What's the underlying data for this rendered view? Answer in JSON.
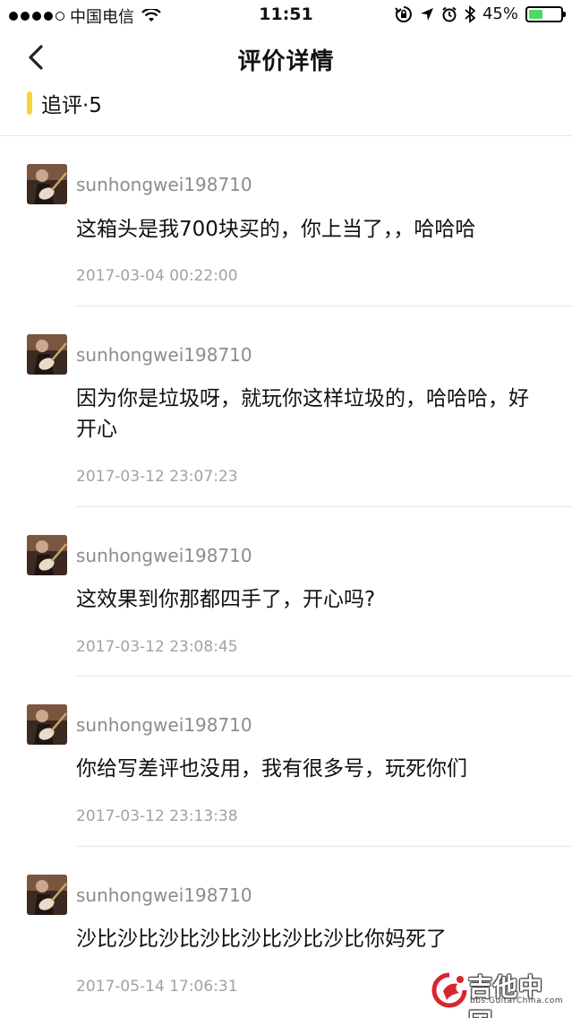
{
  "status_bar": {
    "carrier": "中国电信",
    "time": "11:51",
    "battery_percent": "45%",
    "battery_level": 0.45,
    "icons": [
      "wifi-icon",
      "lock-rotation-icon",
      "location-icon",
      "alarm-icon",
      "bluetooth-icon",
      "battery-icon"
    ]
  },
  "nav": {
    "title": "评价详情",
    "back_icon": "chevron-left-icon"
  },
  "section": {
    "label": "追评·5",
    "accent_color": "#f9d338"
  },
  "comments": [
    {
      "username": "sunhongwei198710",
      "content": "这箱头是我700块买的，你上当了，，哈哈哈",
      "time": "2017-03-04 00:22:00"
    },
    {
      "username": "sunhongwei198710",
      "content": "因为你是垃圾呀，就玩你这样垃圾的，哈哈哈，好开心",
      "time": "2017-03-12 23:07:23"
    },
    {
      "username": "sunhongwei198710",
      "content": "这效果到你那都四手了，开心吗?",
      "time": "2017-03-12 23:08:45"
    },
    {
      "username": "sunhongwei198710",
      "content": "你给写差评也没用，我有很多号，玩死你们",
      "time": "2017-03-12 23:13:38"
    },
    {
      "username": "sunhongwei198710",
      "content": "沙比沙比沙比沙比沙比沙比沙比你妈死了",
      "time": "2017-05-14 17:06:31"
    }
  ],
  "watermark": {
    "text": "吉他中国",
    "sub": "bbs.GuitarChina.com"
  }
}
